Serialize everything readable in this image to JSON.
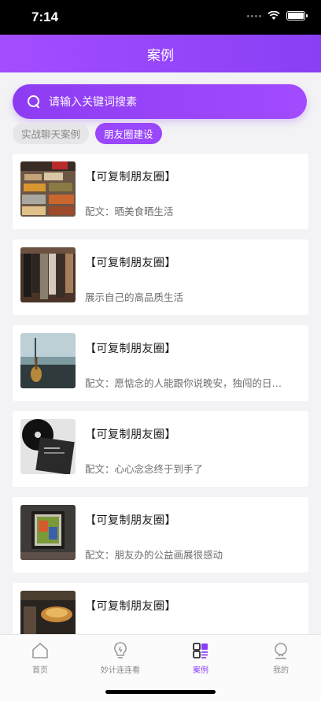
{
  "status": {
    "time": "7:14"
  },
  "nav": {
    "title": "案例"
  },
  "search": {
    "placeholder": "请输入关键词搜素"
  },
  "tabs": [
    {
      "label": "实战聊天案例",
      "active": false
    },
    {
      "label": "朋友圈建设",
      "active": true
    }
  ],
  "cards": [
    {
      "title": "【可复制朋友圈】",
      "desc": "配文：晒美食晒生活",
      "thumb": "food-buffet-photo"
    },
    {
      "title": "【可复制朋友圈】",
      "desc": "展示自己的高品质生活",
      "thumb": "clothes-rack-photo"
    },
    {
      "title": "【可复制朋友圈】",
      "desc": "配文：愿惦念的人能跟你说晚安，独闯的日…",
      "thumb": "guitar-rooftop-photo"
    },
    {
      "title": "【可复制朋友圈】",
      "desc": "配文：心心念念终于到手了",
      "thumb": "vinyl-record-photo"
    },
    {
      "title": "【可复制朋友圈】",
      "desc": "配文：朋友办的公益画展很感动",
      "thumb": "painting-exhibition-photo"
    },
    {
      "title": "【可复制朋友圈】",
      "desc": "",
      "thumb": "restaurant-food-photo"
    }
  ],
  "tabbar": {
    "items": [
      {
        "label": "首页",
        "icon": "home-icon"
      },
      {
        "label": "妙计连连看",
        "icon": "lightbulb-icon"
      },
      {
        "label": "案例",
        "icon": "cases-icon"
      },
      {
        "label": "我的",
        "icon": "profile-icon"
      }
    ]
  },
  "colors": {
    "accent": "#9a46fb",
    "accent_dark": "#8a3ff5"
  }
}
